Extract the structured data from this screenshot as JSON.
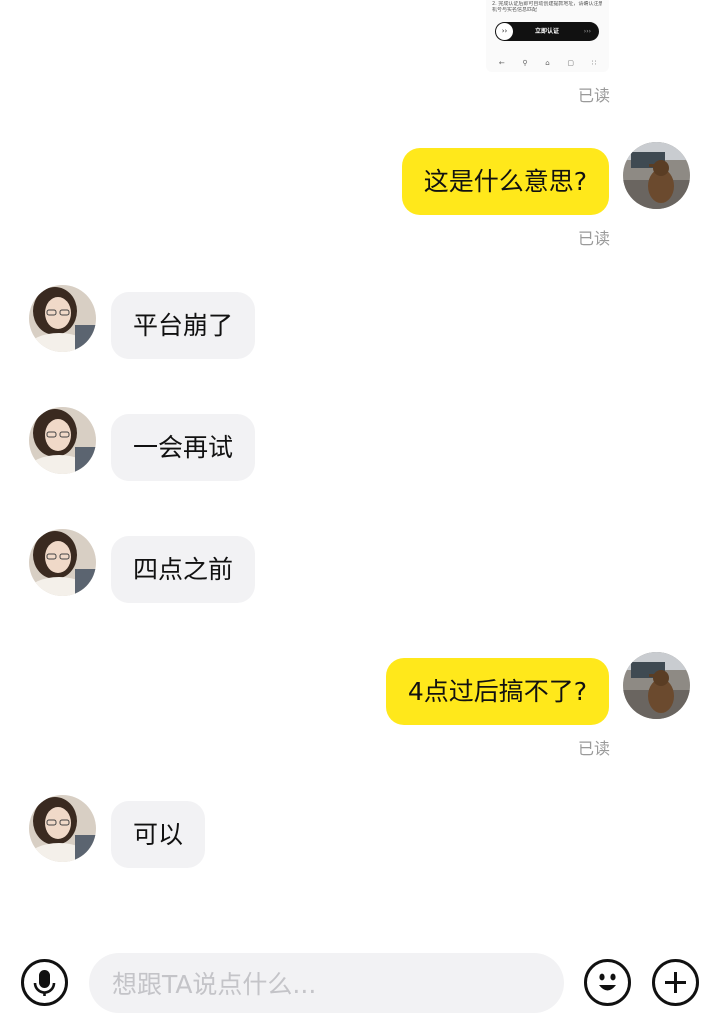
{
  "screenshot_message": {
    "lines": [
      "2. 完成认证后即可自动创建提款地址，请确认注册手",
      "机号与实名信息匹配"
    ],
    "button_label": "立即认证",
    "read_status": "已读"
  },
  "messages": [
    {
      "side": "me",
      "text": "这是什么意思?",
      "read_status": "已读"
    },
    {
      "side": "other",
      "text": "平台崩了"
    },
    {
      "side": "other",
      "text": "一会再试"
    },
    {
      "side": "other",
      "text": "四点之前"
    },
    {
      "side": "me",
      "text": "4点过后搞不了?",
      "read_status": "已读"
    },
    {
      "side": "other",
      "text": "可以"
    }
  ],
  "input_bar": {
    "placeholder": "想跟TA说点什么...",
    "voice_icon": "microphone-icon",
    "emoji_icon": "emoji-icon",
    "add_icon": "plus-icon"
  },
  "colors": {
    "outgoing_bubble": "#ffe81b",
    "incoming_bubble": "#f2f2f4",
    "read_text": "#9a9a9a"
  }
}
